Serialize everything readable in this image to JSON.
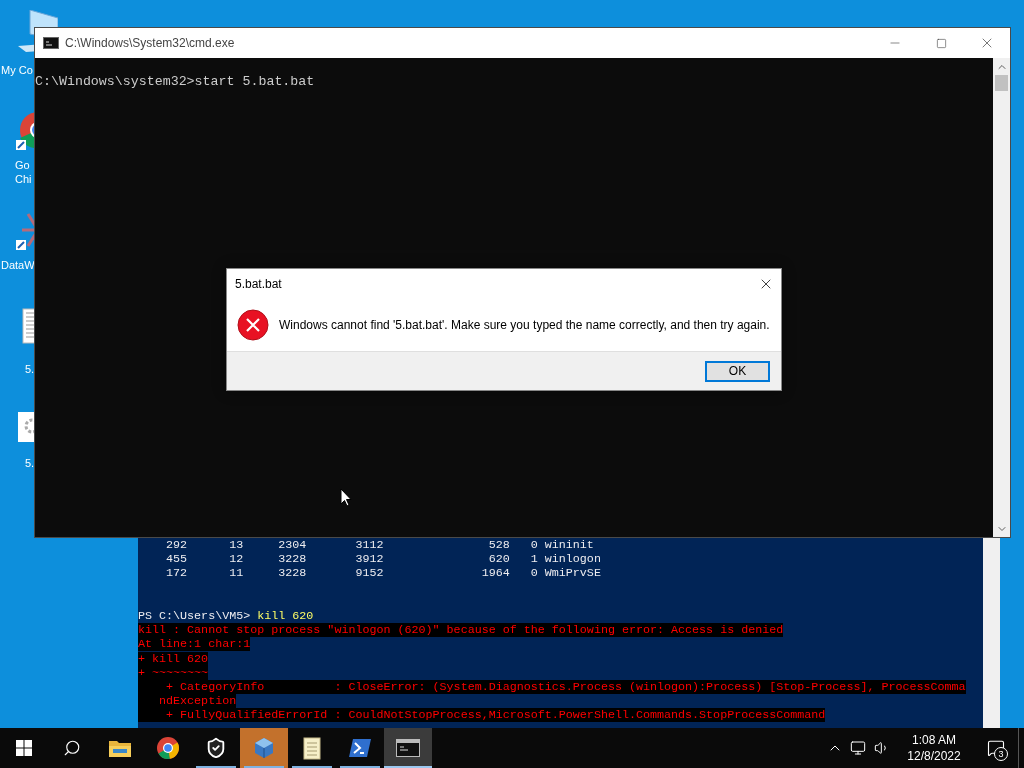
{
  "desktop_icons": [
    {
      "kind": "computer",
      "labels": [
        "My Co"
      ]
    },
    {
      "kind": "browser",
      "labels": [
        "Go",
        "Chi"
      ]
    },
    {
      "kind": "app",
      "labels": [
        "DataW"
      ]
    },
    {
      "kind": "file",
      "labels": [
        "5."
      ]
    },
    {
      "kind": "settings-file",
      "labels": [
        "5."
      ]
    }
  ],
  "powershell": {
    "lines": [
      {
        "kind": "output",
        "text": "    292      13     2304       3112               528   0 wininit"
      },
      {
        "kind": "output",
        "text": "    455      12     3228       3912               620   1 winlogon"
      },
      {
        "kind": "output",
        "text": "    172      11     3228       9152              1964   0 WmiPrvSE"
      },
      {
        "kind": "blank"
      },
      {
        "kind": "blank"
      },
      {
        "kind": "prompt",
        "prompt": "PS C:\\Users\\VM5> ",
        "command": "kill 620"
      },
      {
        "kind": "error",
        "text": "kill : Cannot stop process \"winlogon (620)\" because of the following error: Access is denied"
      },
      {
        "kind": "error",
        "text": "At line:1 char:1"
      },
      {
        "kind": "error",
        "text": "+ kill 620"
      },
      {
        "kind": "error",
        "text": "+ ~~~~~~~~"
      },
      {
        "kind": "error",
        "text": "    + CategoryInfo          : CloseError: (System.Diagnostics.Process (winlogon):Process) [Stop-Process], ProcessComma"
      },
      {
        "kind": "error",
        "text": "   ndException"
      },
      {
        "kind": "error",
        "text": "    + FullyQualifiedErrorId : CouldNotStopProcess,Microsoft.PowerShell.Commands.StopProcessCommand"
      }
    ]
  },
  "cmd_window": {
    "title": "C:\\Windows\\System32\\cmd.exe",
    "lines": [
      "C:\\Windows\\system32>start 5.bat.bat"
    ]
  },
  "dialog": {
    "title": "5.bat.bat",
    "message": "Windows cannot find '5.bat.bat'. Make sure you typed the name correctly, and then try again.",
    "buttons": [
      "OK"
    ]
  },
  "taskbar": {
    "apps": [
      {
        "kind": "folder",
        "running": false,
        "selected": false,
        "flashing": false
      },
      {
        "kind": "chrome",
        "running": false,
        "selected": false,
        "flashing": false
      },
      {
        "kind": "shield",
        "running": true,
        "selected": false,
        "flashing": false
      },
      {
        "kind": "cube",
        "running": true,
        "selected": false,
        "flashing": true
      },
      {
        "kind": "notepad",
        "running": true,
        "selected": false,
        "flashing": false
      },
      {
        "kind": "powershell",
        "running": true,
        "selected": false,
        "flashing": false
      },
      {
        "kind": "cmd",
        "running": true,
        "selected": true,
        "flashing": false
      }
    ],
    "time": "1:08 AM",
    "date": "12/8/2022",
    "notification_count": "3"
  }
}
